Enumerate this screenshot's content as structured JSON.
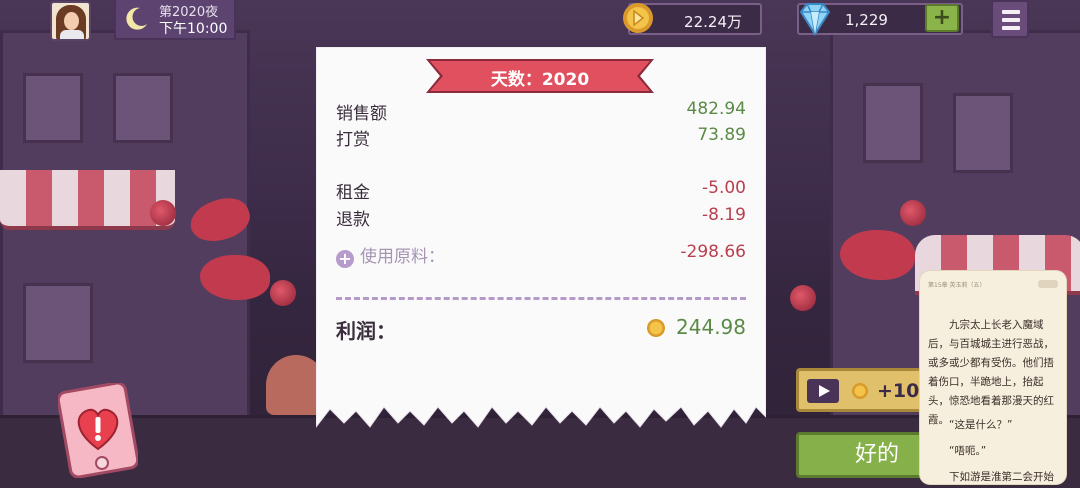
{
  "top_bar": {
    "night_label": "第2020夜",
    "time_label": "下午10:00",
    "coins": "22.24万",
    "gems": "1,229",
    "add_gems_label": "+"
  },
  "receipt": {
    "title": "天数：2020",
    "sales_label": "销售额",
    "sales_value": "482.94",
    "tips_label": "打赏",
    "tips_value": "73.89",
    "rent_label": "租金",
    "rent_value": "-5.00",
    "refund_label": "退款",
    "refund_value": "-8.19",
    "ingredients_label": "使用原料：",
    "ingredients_value": "-298.66",
    "profit_label": "利润：",
    "profit_value": "244.98"
  },
  "ad_button": {
    "amount": "+10"
  },
  "ok_button": {
    "label": "好的"
  },
  "reader": {
    "header_small": "第15章 英玉莉（五）",
    "header_button": "",
    "p1": "九宗太上长老入魔域后，与百城城主进行恶战，或多或少都有受伤。他们捂着伤口，半跪地上，抬起头，惊恐地看着那漫天的红霞。",
    "p2": "“这是什么？”",
    "p3": "“唔呃。”",
    "p4": "下如游是淮第二会开始"
  },
  "colors": {
    "positive": "#5a8a46",
    "negative": "#b8404e",
    "ribbon": "#e0505e",
    "ok_green": "#86b04a"
  }
}
